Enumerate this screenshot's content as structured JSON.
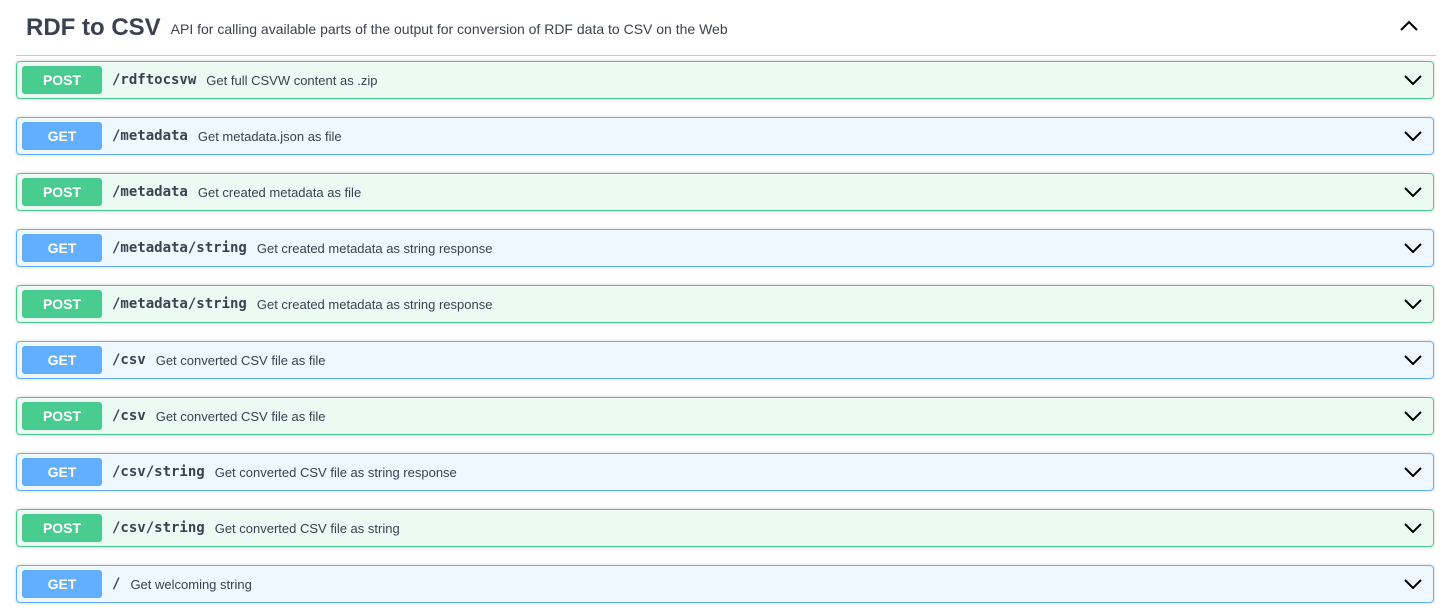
{
  "tag": {
    "name": "RDF to CSV",
    "description": "API for calling available parts of the output for conversion of RDF data to CSV on the Web",
    "toggle_icon": "chevron-up-icon"
  },
  "operations": [
    {
      "method": "POST",
      "path": "/rdftocsvw",
      "summary": "Get full CSVW content as .zip"
    },
    {
      "method": "GET",
      "path": "/metadata",
      "summary": "Get metadata.json as file"
    },
    {
      "method": "POST",
      "path": "/metadata",
      "summary": "Get created metadata as file"
    },
    {
      "method": "GET",
      "path": "/metadata/string",
      "summary": "Get created metadata as string response"
    },
    {
      "method": "POST",
      "path": "/metadata/string",
      "summary": "Get created metadata as string response"
    },
    {
      "method": "GET",
      "path": "/csv",
      "summary": "Get converted CSV file as file"
    },
    {
      "method": "POST",
      "path": "/csv",
      "summary": "Get converted CSV file as file"
    },
    {
      "method": "GET",
      "path": "/csv/string",
      "summary": "Get converted CSV file as string response"
    },
    {
      "method": "POST",
      "path": "/csv/string",
      "summary": "Get converted CSV file as string"
    },
    {
      "method": "GET",
      "path": "/",
      "summary": "Get welcoming string"
    }
  ],
  "colors": {
    "post": "#49cc90",
    "get": "#61affe",
    "text": "#3b4151"
  },
  "icons": {
    "operation_toggle": "chevron-down-icon"
  }
}
